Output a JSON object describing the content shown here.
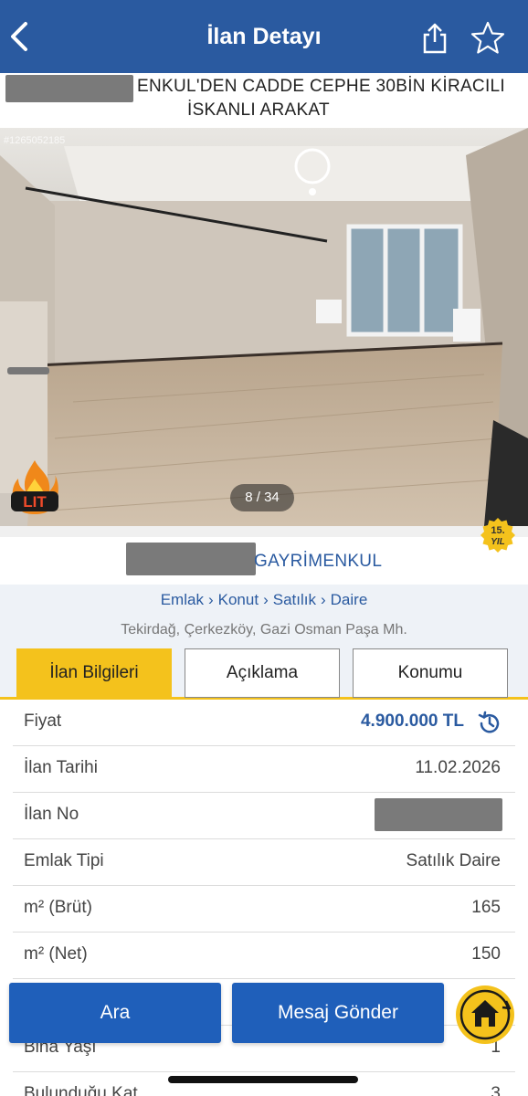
{
  "header": {
    "title": "İlan Detayı",
    "back_icon": "chevron-left-icon",
    "share_icon": "share-icon",
    "favorite_icon": "star-icon"
  },
  "listing": {
    "title_line1": "ENKUL'DEN CADDE CEPHE 30BİN KİRACILI",
    "title_line2": "İSKANLI ARAKAT"
  },
  "photo": {
    "ref_text": "#1265052185",
    "counter": "8 / 34",
    "badge_text": "LIT"
  },
  "store": {
    "name": "GAYRİMENKUL",
    "year_badge_num": "15.",
    "year_badge_text": "YIL"
  },
  "breadcrumb": [
    "Emlak",
    "Konut",
    "Satılık",
    "Daire"
  ],
  "location": "Tekirdağ, Çerkezköy, Gazi Osman Paşa Mh.",
  "tabs": [
    {
      "label": "İlan Bilgileri",
      "active": true
    },
    {
      "label": "Açıklama",
      "active": false
    },
    {
      "label": "Konumu",
      "active": false
    }
  ],
  "info": {
    "price_label": "Fiyat",
    "price_value": "4.900.000 TL",
    "date_label": "İlan Tarihi",
    "date_value": "11.02.2026",
    "no_label": "İlan No",
    "type_label": "Emlak Tipi",
    "type_value": "Satılık Daire",
    "brut_label": "m² (Brüt)",
    "brut_value": "165",
    "net_label": "m² (Net)",
    "net_value": "150",
    "age_label": "Bina Yaşı",
    "age_value": "1",
    "floor_label": "Bulunduğu Kat",
    "floor_value": "3"
  },
  "actions": {
    "call_label": "Ara",
    "message_label": "Mesaj Gönder"
  },
  "colors": {
    "primary": "#2a5aa0",
    "button": "#1f5fba",
    "accent": "#f4c21c"
  }
}
